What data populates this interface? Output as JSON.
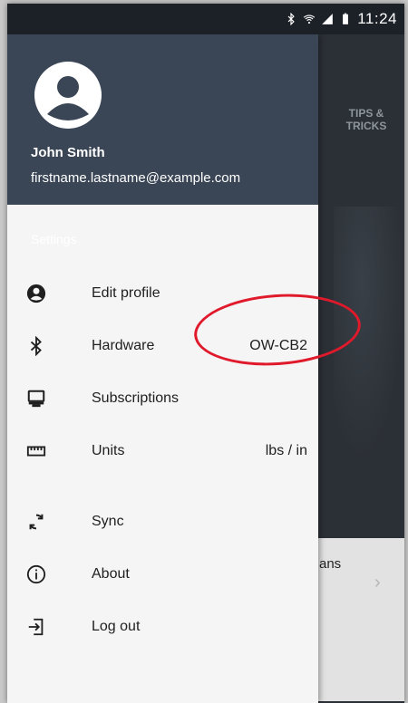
{
  "status_bar": {
    "time": "11:24",
    "icons": [
      "bluetooth-icon",
      "wifi-icon",
      "signal-icon",
      "battery-icon"
    ]
  },
  "background_app": {
    "tab_label": "TIPS & TRICKS",
    "card_text": "ans",
    "card_chevron": "›"
  },
  "drawer": {
    "header": {
      "name": "John Smith",
      "email": "firstname.lastname@example.com"
    },
    "section_label": "Settings",
    "items": [
      {
        "label": "Edit profile",
        "icon": "account-circle-icon",
        "value": ""
      },
      {
        "label": "Hardware",
        "icon": "bluetooth-icon",
        "value": "OW-CB2"
      },
      {
        "label": "Subscriptions",
        "icon": "subscriptions-icon",
        "value": ""
      },
      {
        "label": "Units",
        "icon": "ruler-icon",
        "value": "lbs / in"
      },
      {
        "label": "Sync",
        "icon": "sync-icon",
        "value": ""
      },
      {
        "label": "About",
        "icon": "info-icon",
        "value": ""
      },
      {
        "label": "Log out",
        "icon": "logout-icon",
        "value": ""
      }
    ]
  },
  "colors": {
    "header_bg": "#3a4656",
    "drawer_bg": "#f5f5f5",
    "annotation": "#e0192b"
  }
}
